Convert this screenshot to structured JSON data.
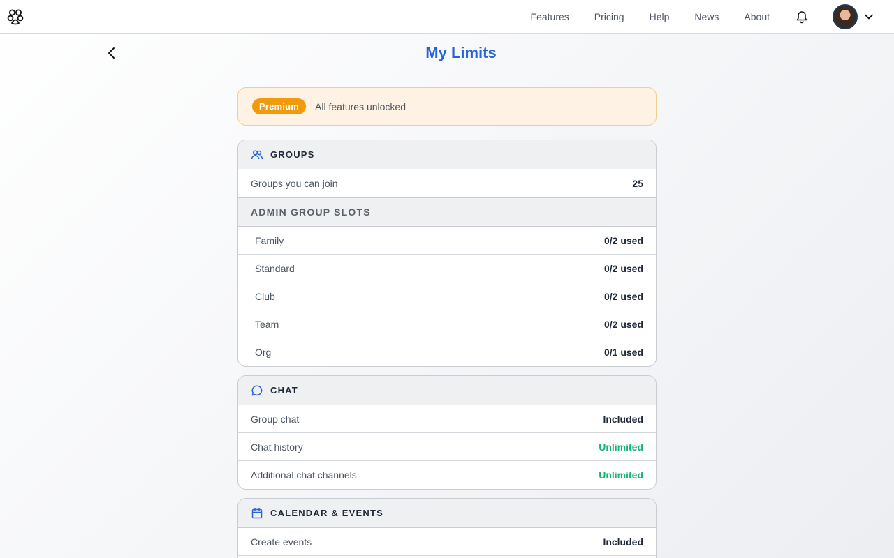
{
  "nav": {
    "links": [
      "Features",
      "Pricing",
      "Help",
      "News",
      "About"
    ]
  },
  "page": {
    "title": "My Limits"
  },
  "banner": {
    "badge": "Premium",
    "text": "All features unlocked"
  },
  "groups": {
    "title": "GROUPS",
    "rows": [
      {
        "label": "Groups you can join",
        "value": "25"
      }
    ],
    "admin_title": "ADMIN GROUP SLOTS",
    "admin_rows": [
      {
        "label": "Family",
        "value": "0/2 used"
      },
      {
        "label": "Standard",
        "value": "0/2 used"
      },
      {
        "label": "Club",
        "value": "0/2 used"
      },
      {
        "label": "Team",
        "value": "0/2 used"
      },
      {
        "label": "Org",
        "value": "0/1 used"
      }
    ]
  },
  "chat": {
    "title": "CHAT",
    "rows": [
      {
        "label": "Group chat",
        "value": "Included"
      },
      {
        "label": "Chat history",
        "value": "Unlimited"
      },
      {
        "label": "Additional chat channels",
        "value": "Unlimited"
      }
    ]
  },
  "calendar": {
    "title": "CALENDAR & EVENTS",
    "rows": [
      {
        "label": "Create events",
        "value": "Included"
      }
    ]
  },
  "colors": {
    "accent": "#2563d9",
    "premium": "#f09a0c",
    "unlimited": "#16b373"
  }
}
